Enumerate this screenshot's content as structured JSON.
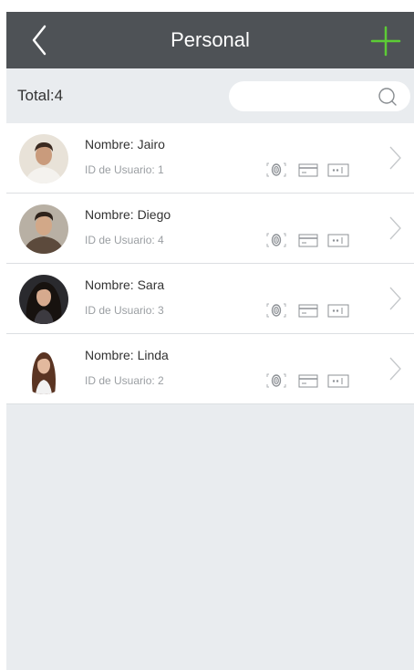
{
  "header": {
    "title": "Personal"
  },
  "toolbar": {
    "total_label": "Total:4",
    "search_placeholder": ""
  },
  "users": [
    {
      "name": "Nombre: Jairo",
      "user_id": "ID de Usuario: 1"
    },
    {
      "name": "Nombre: Diego",
      "user_id": "ID de Usuario: 4"
    },
    {
      "name": "Nombre: Sara",
      "user_id": "ID de Usuario: 3"
    },
    {
      "name": "Nombre: Linda",
      "user_id": "ID de Usuario: 2"
    }
  ],
  "icons": {
    "back": "chevron-left-icon",
    "add": "plus-icon",
    "search": "search-icon",
    "fingerprint": "fingerprint-icon",
    "card": "card-icon",
    "password": "password-icon",
    "row_arrow": "chevron-right-icon"
  },
  "colors": {
    "header_bg": "#4e5256",
    "accent": "#5ccc35",
    "page_bg": "#e9ecef"
  }
}
